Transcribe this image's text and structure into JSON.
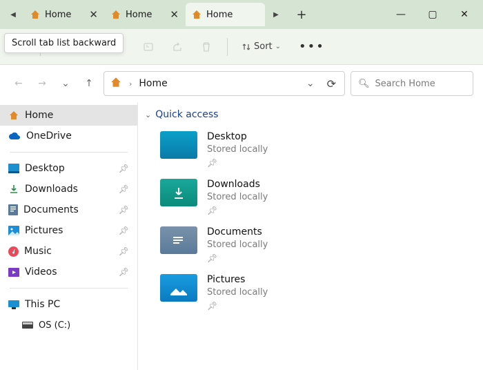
{
  "tooltip": "Scroll tab list backward",
  "tabs": {
    "scroll_back_icon": "◀",
    "scroll_fwd_icon": "▶",
    "items": [
      {
        "label": "Home",
        "active": false
      },
      {
        "label": "Home",
        "active": false
      },
      {
        "label": "Home",
        "active": true
      }
    ],
    "new_tab": "+"
  },
  "window_controls": {
    "min": "—",
    "max": "▢",
    "close": "✕"
  },
  "toolbar": {
    "sort_label": "Sort"
  },
  "nav": {
    "back": "←",
    "fwd": "→",
    "recent": "⌄",
    "up": "↑"
  },
  "address": {
    "crumb": "Home",
    "dropdown_icon": "⌄",
    "refresh_icon": "⟳"
  },
  "search": {
    "placeholder": "Search Home",
    "icon": "🔍"
  },
  "sidebar": {
    "home": "Home",
    "onedrive": "OneDrive",
    "items": [
      {
        "icon": "desktop",
        "label": "Desktop"
      },
      {
        "icon": "downloads",
        "label": "Downloads"
      },
      {
        "icon": "documents",
        "label": "Documents"
      },
      {
        "icon": "pictures",
        "label": "Pictures"
      },
      {
        "icon": "music",
        "label": "Music"
      },
      {
        "icon": "videos",
        "label": "Videos"
      }
    ],
    "thispc": "This PC",
    "osdrive": "OS (C:)"
  },
  "content": {
    "section_title": "Quick access",
    "items": [
      {
        "title": "Desktop",
        "sub": "Stored locally",
        "color": "#18a6c4"
      },
      {
        "title": "Downloads",
        "sub": "Stored locally",
        "color": "#1a9c8c"
      },
      {
        "title": "Documents",
        "sub": "Stored locally",
        "color": "#6f8aa5"
      },
      {
        "title": "Pictures",
        "sub": "Stored locally",
        "color": "#1a8fd6"
      }
    ]
  }
}
